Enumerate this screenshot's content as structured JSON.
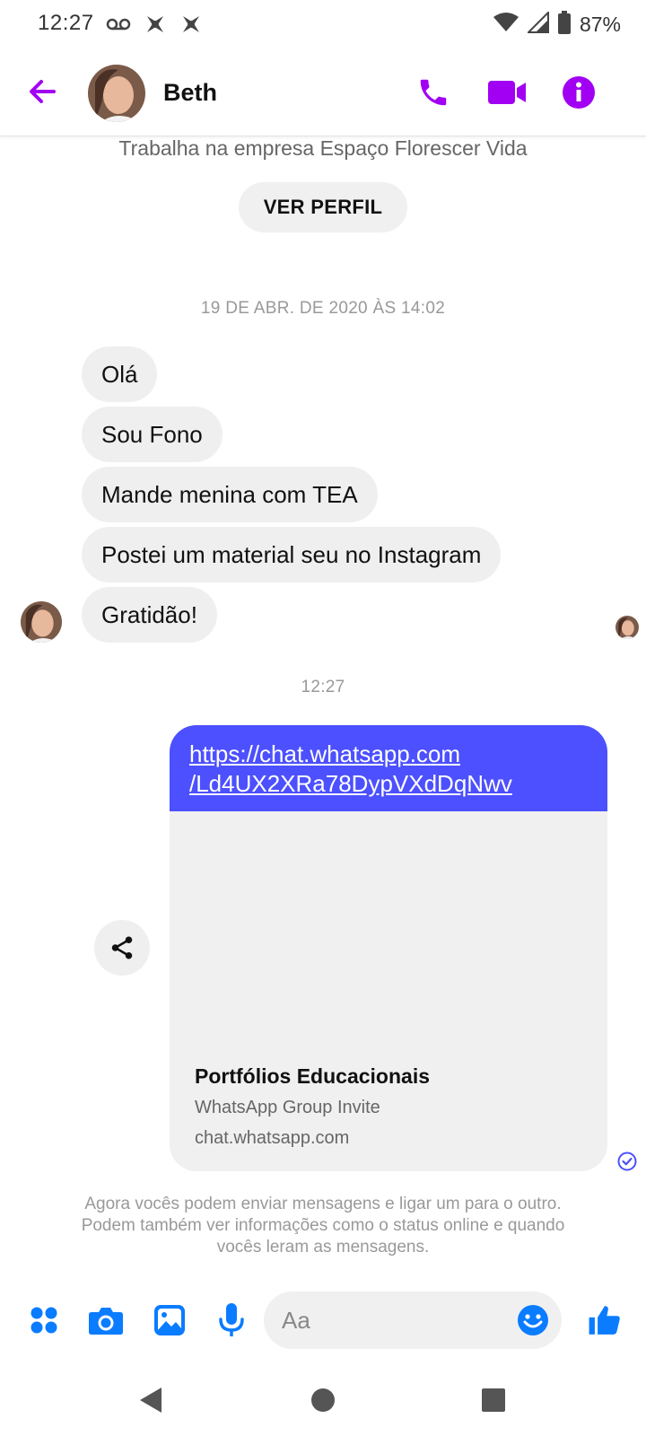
{
  "status_bar": {
    "time": "12:27",
    "battery": "87%",
    "icons_left": [
      "voicemail-icon",
      "app-notification-icon",
      "app-notification-icon"
    ],
    "icons_right": [
      "wifi-icon",
      "signal-icon",
      "battery-icon"
    ]
  },
  "header": {
    "contact_name": "Beth",
    "actions": [
      "back-icon",
      "phone-icon",
      "video-icon",
      "info-icon"
    ],
    "accent_color": "#a100f2"
  },
  "profile": {
    "subtitle": "Trabalha na empresa Espaço Florescer Vida",
    "view_profile_label": "VER PERFIL"
  },
  "conversation": {
    "timestamp_1": "19 DE ABR. DE 2020 ÀS 14:02",
    "incoming_messages": [
      "Olá",
      "Sou Fono",
      "Mande menina com TEA",
      "Postei um material seu no Instagram",
      "Gratidão!"
    ],
    "timestamp_2": "12:27",
    "outgoing_link": {
      "url_line_1": "https://chat.whatsapp.com",
      "url_line_2": "/Ld4UX2XRa78DypVXdDqNwv",
      "title": "Portfólios Educacionais",
      "description": "WhatsApp Group Invite",
      "domain": "chat.whatsapp.com",
      "bubble_color": "#4c50fe"
    },
    "notice": "Agora vocês podem enviar mensagens e ligar um para o outro. Podem também ver informações como o status online e quando vocês leram as mensagens."
  },
  "composer": {
    "placeholder": "Aa",
    "icons": [
      "apps-icon",
      "camera-icon",
      "gallery-icon",
      "microphone-icon",
      "emoji-icon",
      "thumbs-up-icon"
    ],
    "icon_color": "#0a7cff"
  },
  "nav": {
    "icons": [
      "back-triangle-icon",
      "home-circle-icon",
      "recents-square-icon"
    ]
  }
}
